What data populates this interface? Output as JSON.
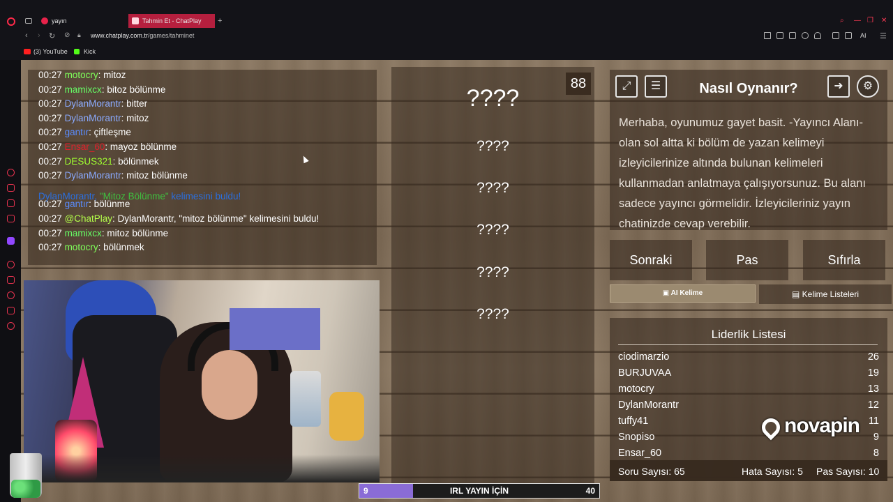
{
  "browser": {
    "tabs": [
      {
        "label": "yayın",
        "favicon": "opera-icon"
      },
      {
        "label": "Tahmin Et - ChatPlay",
        "favicon": "chatplay-icon",
        "favicon_text": "CP",
        "active": true
      }
    ],
    "new_tab": "+",
    "url_host": "www.chatplay.com.tr",
    "url_path": "/games/tahminet",
    "ai_label": "AI",
    "bookmarks": [
      {
        "label": "(3) YouTube",
        "icon": "youtube-icon"
      },
      {
        "label": "Kick",
        "icon": "kick-icon"
      }
    ],
    "accent_color": "#ff2a4a"
  },
  "chat": {
    "messages": [
      {
        "time": "00:27",
        "user": "motocry",
        "user_color": "#7fff5a",
        "text": "mitoz"
      },
      {
        "time": "00:27",
        "user": "mamixcx",
        "user_color": "#66ff66",
        "text": "bitoz bölünme"
      },
      {
        "time": "00:27",
        "user": "DylanMorantr",
        "user_color": "#8aaaff",
        "text": "bitter"
      },
      {
        "time": "00:27",
        "user": "DylanMorantr",
        "user_color": "#8aaaff",
        "text": "mitoz"
      },
      {
        "time": "00:27",
        "user": "gantır",
        "user_color": "#5a8cff",
        "text": "çiftleşme"
      },
      {
        "time": "00:27",
        "user": "Ensar_60",
        "user_color": "#e0202a",
        "text": "mayoz bölünme"
      },
      {
        "time": "00:27",
        "user": "DESUS321",
        "user_color": "#a0ff30",
        "text": "bölünmek"
      },
      {
        "time": "00:27",
        "user": "DylanMorantr",
        "user_color": "#8aaaff",
        "text": "mitoz bölünme"
      },
      {
        "time": "",
        "user": "",
        "user_color": "",
        "text": ""
      },
      {
        "time": "00:27",
        "user": "gantır",
        "user_color": "#5a8cff",
        "text": "bölünme"
      },
      {
        "time": "00:27",
        "user": "@ChatPlay",
        "user_color": "#b4ff4a",
        "text": "DylanMorantr, \"mitoz bölünme\" kelimesini buldu!"
      },
      {
        "time": "00:27",
        "user": "mamixcx",
        "user_color": "#66ff66",
        "text": "mitoz bölünme"
      },
      {
        "time": "00:27",
        "user": "motocry",
        "user_color": "#7fff5a",
        "text": "bölünmek"
      }
    ],
    "system_message": {
      "part1": "DylanMorantr, ",
      "part2": "\"Mitoz Bölünme\"",
      "part3": " kelimesini buldu!",
      "color": "#2a6fe0",
      "highlight_color": "#3fbf3f"
    }
  },
  "game": {
    "timer": "88",
    "words": [
      "????",
      "????",
      "????",
      "????",
      "????",
      "????"
    ],
    "how_title": "Nasıl Oynanır?",
    "how_text": "Merhaba, oyunumuz gayet basit. -Yayıncı Alanı- olan sol altta ki bölüm de yazan kelimeyi izleyicilerinize altında bulunan kelimeleri kullanmadan anlatmaya çalışıyorsunuz. Bu alanı sadece yayıncı görmelidir. İzleyicileriniz yayın chatinizde cevap verebilir.",
    "buttons": {
      "next": "Sonraki",
      "pass": "Pas",
      "reset": "Sıfırla"
    },
    "ai_word_button": "AI Kelime",
    "word_lists_button": "Kelime Listeleri",
    "leaderboard_title": "Liderlik Listesi",
    "leaderboard": [
      {
        "name": "ciodimarzio",
        "score": "26"
      },
      {
        "name": "BURJUVAA",
        "score": "19"
      },
      {
        "name": "motocry",
        "score": "13"
      },
      {
        "name": "DylanMorantr",
        "score": "12"
      },
      {
        "name": "tuffy41",
        "score": "11"
      },
      {
        "name": "Snopiso",
        "score": "9"
      },
      {
        "name": "Ensar_60",
        "score": "8"
      }
    ],
    "stats": {
      "questions": "Soru Sayısı: 65",
      "errors": "Hata Sayısı: 5",
      "passes": "Pas Sayısı: 10"
    }
  },
  "progress": {
    "start": "9",
    "label": "IRL YAYIN İÇİN",
    "end": "40",
    "fraction": 0.225
  },
  "overlay": {
    "brand": "novapin"
  }
}
